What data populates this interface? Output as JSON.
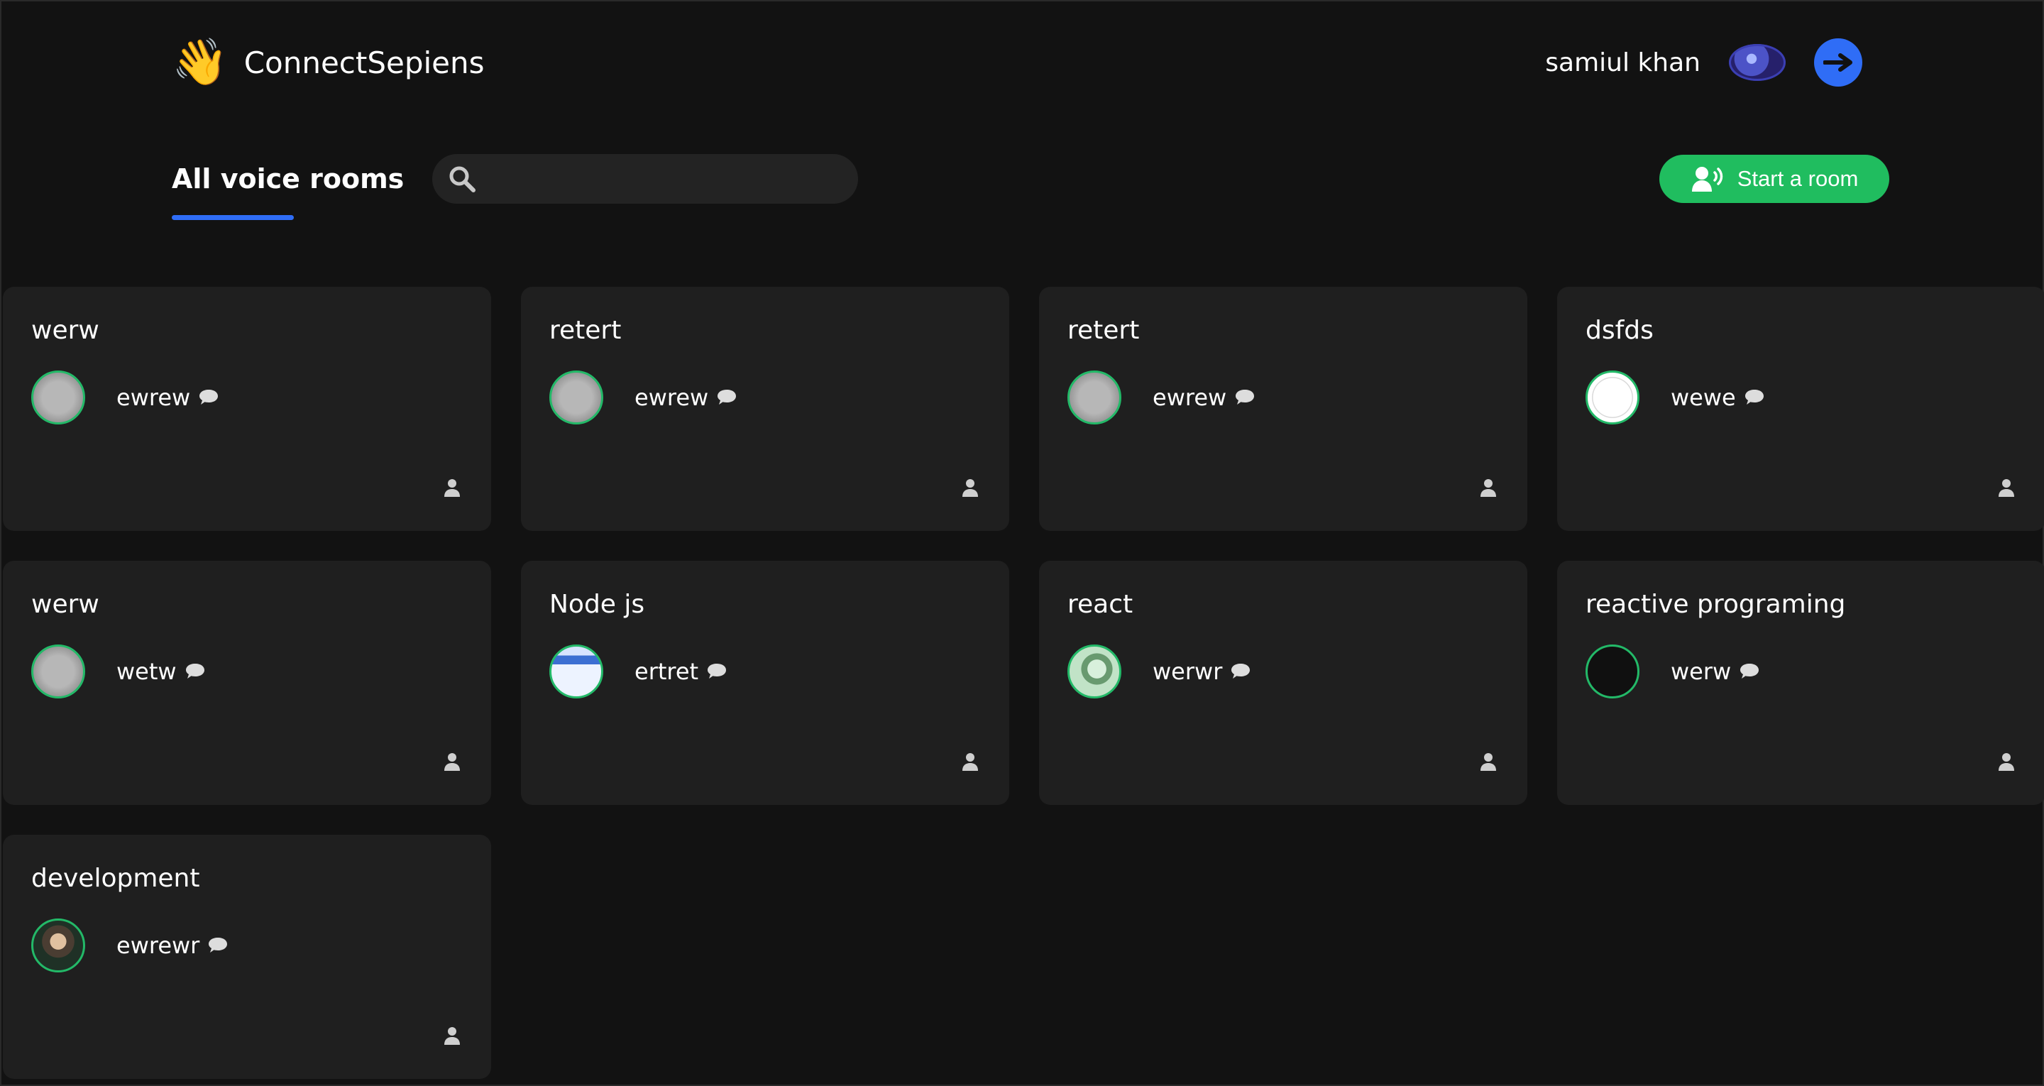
{
  "header": {
    "brand_emoji": "👋",
    "brand_name": "ConnectSepiens",
    "user_name": "samiul khan",
    "icons": {
      "logout": "arrow-right-icon"
    }
  },
  "toolbar": {
    "title": "All voice rooms",
    "search_placeholder": "",
    "start_room_label": "Start a room",
    "accent_color": "#20bd5f"
  },
  "rooms": [
    {
      "title": "werw",
      "speaker": "ewrew",
      "avatar_style": "gray"
    },
    {
      "title": "retert",
      "speaker": "ewrew",
      "avatar_style": "gray"
    },
    {
      "title": "retert",
      "speaker": "ewrew",
      "avatar_style": "gray"
    },
    {
      "title": "dsfds",
      "speaker": "wewe",
      "avatar_style": "sketch"
    },
    {
      "title": "werw",
      "speaker": "wetw",
      "avatar_style": "gray"
    },
    {
      "title": "Node js",
      "speaker": "ertret",
      "avatar_style": "screen"
    },
    {
      "title": "react",
      "speaker": "werwr",
      "avatar_style": "leaf"
    },
    {
      "title": "reactive programing",
      "speaker": "werw",
      "avatar_style": "dark"
    },
    {
      "title": "development",
      "speaker": "ewrewr",
      "avatar_style": "photo"
    }
  ]
}
